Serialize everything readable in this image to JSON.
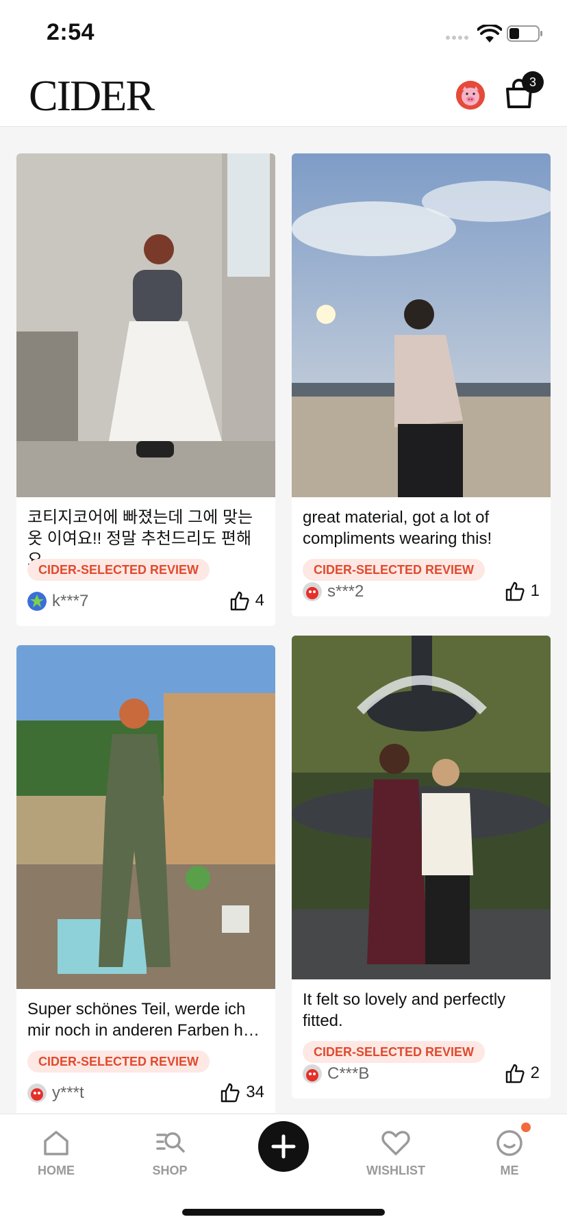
{
  "status_bar": {
    "time": "2:54"
  },
  "header": {
    "logo": "CIDER",
    "cart_count": "3"
  },
  "reviews": [
    {
      "text": "코티지코어에 빠졌는데 그에 맞는 옷 이여요!! 정말 추천드리도 편해요…",
      "badge": "CIDER-SELECTED REVIEW",
      "user": "k***7",
      "likes": "4"
    },
    {
      "text": "great material, got a lot of compliments wearing this!",
      "badge": "CIDER-SELECTED REVIEW",
      "user": "s***2",
      "likes": "1"
    },
    {
      "text": "Super schönes Teil, werde ich mir noch in anderen Farben h…",
      "badge": "CIDER-SELECTED REVIEW",
      "user": "y***t",
      "likes": "34"
    },
    {
      "text": "It felt so lovely and perfectly fitted.",
      "badge": "CIDER-SELECTED REVIEW",
      "user": "C***B",
      "likes": "2"
    }
  ],
  "tabs": [
    {
      "label": "HOME",
      "icon": "home-icon"
    },
    {
      "label": "SHOP",
      "icon": "search-list-icon"
    },
    {
      "label": "",
      "icon": "plus-icon"
    },
    {
      "label": "WISHLIST",
      "icon": "heart-icon"
    },
    {
      "label": "ME",
      "icon": "smile-face-icon"
    }
  ],
  "colors": {
    "accent": "#e04a2e",
    "pill_bg": "#fde8e4",
    "badge_dot": "#f26a3e"
  }
}
